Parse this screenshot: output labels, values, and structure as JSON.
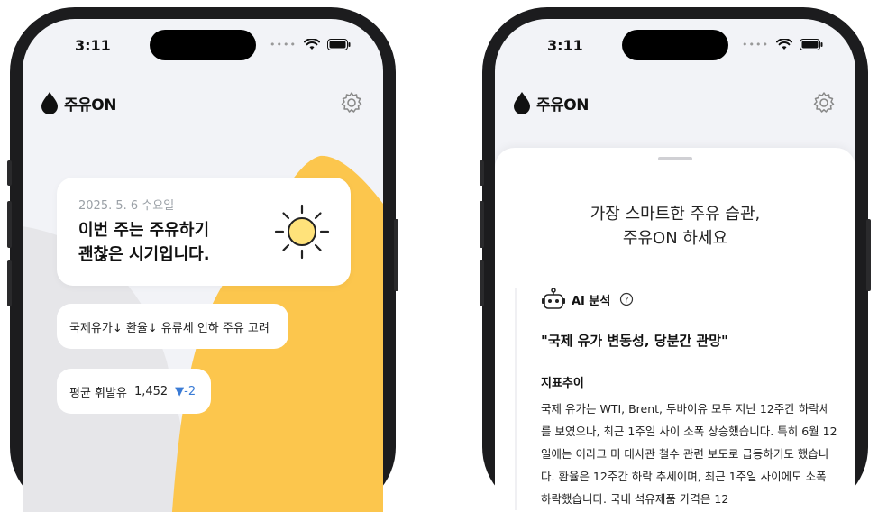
{
  "phones": [
    {
      "status_time": "3:11",
      "app_name": "주유ON",
      "date": "2025. 5. 6 수요일",
      "headline_line1": "이번 주는 주유하기",
      "headline_line2": "괜찮은 시기입니다.",
      "weather_icon": "sun-icon",
      "summary": "국제유가↓ 환율↓ 유류세 인하 주유 고려",
      "price_label": "평균 휘발유",
      "price_value": "1,452",
      "price_change": "▼-2"
    },
    {
      "status_time": "3:11",
      "app_name": "주유ON",
      "tagline_line1": "가장 스마트한 주유 습관,",
      "tagline_line2": "주유ON 하세요",
      "ai_label": "AI 분석",
      "quote": "\"국제 유가 변동성, 당분간 관망\"",
      "section_title": "지표추이",
      "body": "국제 유가는 WTI, Brent, 두바이유 모두 지난 12주간 하락세를 보였으나, 최근 1주일 사이 소폭 상승했습니다. 특히 6월 12일에는 이라크 미 대사관 철수 관련 보도로 급등하기도 했습니다. 환율은 12주간 하락 추세이며, 최근 1주일 사이에도 소폭 하락했습니다. 국내 석유제품 가격은 12"
    }
  ],
  "colors": {
    "accent_yellow": "#fcc64d",
    "bg_gray": "#f2f3f7",
    "decrease_blue": "#3a7bd5"
  }
}
